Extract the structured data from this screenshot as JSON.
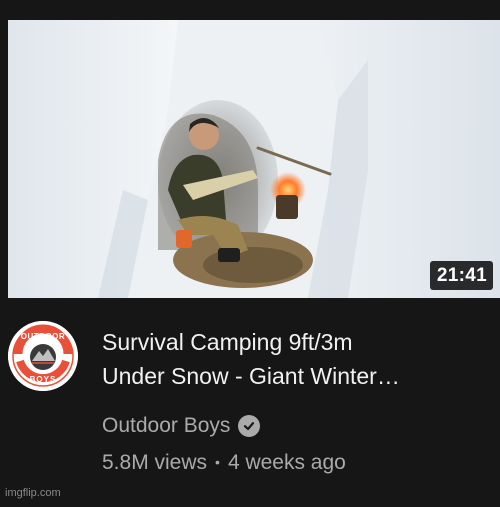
{
  "video": {
    "duration": "21:41",
    "title_line1": "Survival Camping 9ft/3m",
    "title_line2": "Under Snow - Giant Winter…",
    "channel": "Outdoor Boys",
    "views": "5.8M views",
    "separator": "•",
    "age": "4 weeks ago"
  },
  "avatar": {
    "top_text": "OUTDOOR",
    "bottom_text": "BOYS",
    "accent_color": "#e8503a"
  },
  "watermark": "imgflip.com",
  "colors": {
    "background": "#161616",
    "title": "#f1f1f1",
    "meta": "#aaaaaa"
  }
}
